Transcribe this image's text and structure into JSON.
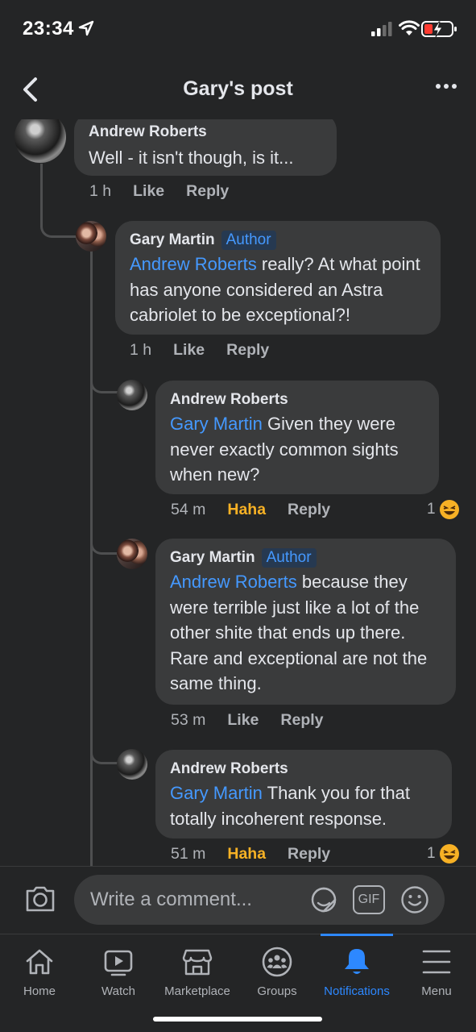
{
  "status": {
    "time": "23:34"
  },
  "header": {
    "title": "Gary's post"
  },
  "comments": [
    {
      "author": "Andrew Roberts",
      "badge": "",
      "mention": "",
      "text": "Well - it isn't though, is it...",
      "time": "1 h",
      "like": "Like",
      "reply": "Reply",
      "reaction_count": ""
    },
    {
      "author": "Gary Martin",
      "badge": "Author",
      "mention": "Andrew Roberts",
      "text": " really? At what point has anyone considered an Astra cabriolet to be exceptional?!",
      "time": "1 h",
      "like": "Like",
      "reply": "Reply",
      "reaction_count": ""
    },
    {
      "author": "Andrew Roberts",
      "badge": "",
      "mention": "Gary Martin",
      "text": " Given they were never exactly common sights when new?",
      "time": "54 m",
      "like": "Haha",
      "reply": "Reply",
      "reaction_count": "1"
    },
    {
      "author": "Gary Martin",
      "badge": "Author",
      "mention": "Andrew Roberts",
      "text": " because they were terrible just like a lot of the other shite that ends up there. Rare and exceptional are not the same thing.",
      "time": "53 m",
      "like": "Like",
      "reply": "Reply",
      "reaction_count": ""
    },
    {
      "author": "Andrew Roberts",
      "badge": "",
      "mention": "Gary Martin",
      "text": " Thank you for that totally incoherent response.",
      "time": "51 m",
      "like": "Haha",
      "reply": "Reply",
      "reaction_count": "1"
    }
  ],
  "composer": {
    "placeholder": "Write a comment...",
    "gif_label": "GIF"
  },
  "tabs": [
    {
      "label": "Home",
      "icon": "home-icon"
    },
    {
      "label": "Watch",
      "icon": "watch-icon"
    },
    {
      "label": "Marketplace",
      "icon": "marketplace-icon"
    },
    {
      "label": "Groups",
      "icon": "groups-icon"
    },
    {
      "label": "Notifications",
      "icon": "bell-icon",
      "active": true
    },
    {
      "label": "Menu",
      "icon": "menu-icon"
    }
  ],
  "colors": {
    "background": "#242526",
    "bubble": "#3a3b3c",
    "link": "#4599ff",
    "haha": "#f7b125",
    "active_tab": "#2d88ff"
  }
}
